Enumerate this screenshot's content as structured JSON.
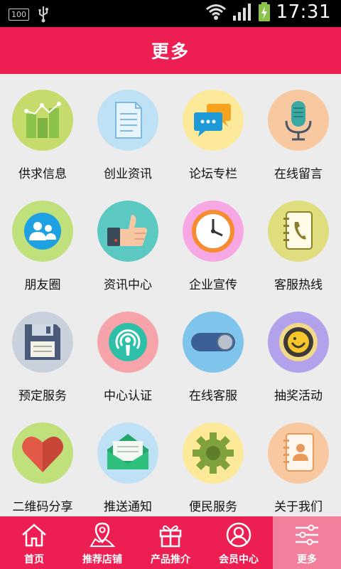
{
  "status_bar": {
    "left_badge": "100",
    "time": "17:31",
    "icons": [
      "battery-level-icon",
      "usb-icon",
      "wifi-icon",
      "signal-icon",
      "battery-charging-icon"
    ]
  },
  "header": {
    "title": "更多"
  },
  "grid": {
    "items": [
      {
        "label": "供求信息",
        "icon": "bar-chart-icon",
        "bg": "#c5dc6d"
      },
      {
        "label": "创业资讯",
        "icon": "document-icon",
        "bg": "#bfe1f6"
      },
      {
        "label": "论坛专栏",
        "icon": "chat-bubbles-icon",
        "bg": "#fde99a"
      },
      {
        "label": "在线留言",
        "icon": "microphone-icon",
        "bg": "#f8c9a0"
      },
      {
        "label": "朋友圈",
        "icon": "friends-icon",
        "bg": "#bfe07a"
      },
      {
        "label": "资讯中心",
        "icon": "thumbs-up-icon",
        "bg": "#5cc8c2"
      },
      {
        "label": "企业宣传",
        "icon": "clock-icon",
        "bg": "#f7a8e4"
      },
      {
        "label": "客服热线",
        "icon": "phone-book-icon",
        "bg": "#dede7e"
      },
      {
        "label": "预定服务",
        "icon": "floppy-disk-icon",
        "bg": "#c8d1dc"
      },
      {
        "label": "中心认证",
        "icon": "podcast-icon",
        "bg": "#f7a3aa"
      },
      {
        "label": "在线客服",
        "icon": "toggle-icon",
        "bg": "#7fc4ea"
      },
      {
        "label": "抽奖活动",
        "icon": "lottery-icon",
        "bg": "#b2a2ec"
      },
      {
        "label": "二维码分享",
        "icon": "heart-icon",
        "bg": "#bfe07a"
      },
      {
        "label": "推送通知",
        "icon": "envelope-icon",
        "bg": "#bfe1f6"
      },
      {
        "label": "便民服务",
        "icon": "gear-icon",
        "bg": "#fde99a"
      },
      {
        "label": "关于我们",
        "icon": "contacts-icon",
        "bg": "#f8c9a0"
      }
    ]
  },
  "tabbar": {
    "items": [
      {
        "label": "首页",
        "icon": "home-icon"
      },
      {
        "label": "推荐店铺",
        "icon": "map-pin-icon"
      },
      {
        "label": "产品推介",
        "icon": "gift-icon"
      },
      {
        "label": "会员中心",
        "icon": "user-icon"
      },
      {
        "label": "更多",
        "icon": "sliders-icon",
        "active": true
      }
    ]
  }
}
